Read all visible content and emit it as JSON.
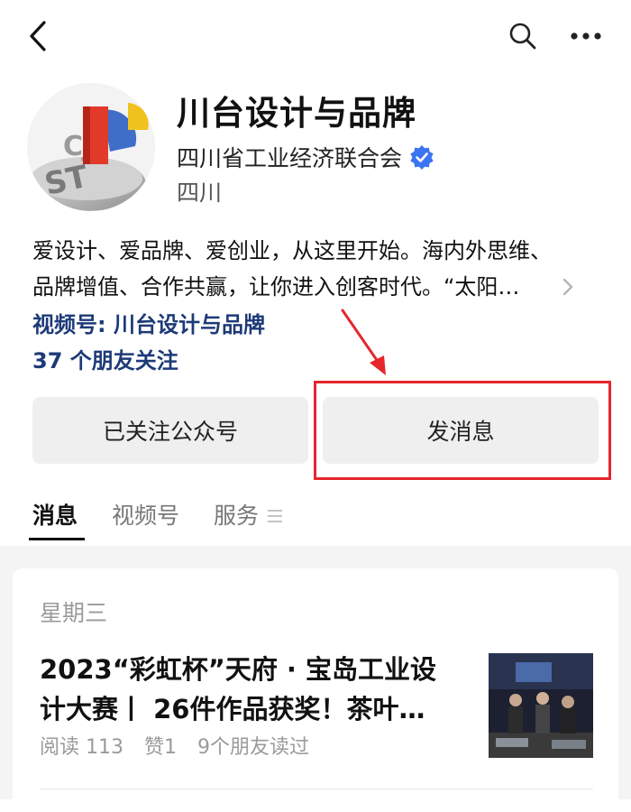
{
  "header": {
    "back_icon": "chevron-left-icon",
    "search_icon": "search-icon",
    "more_icon": "more-dots-icon"
  },
  "profile": {
    "avatar_logo_text": "CJ ST",
    "name": "川台设计与品牌",
    "organization": "四川省工业经济联合会",
    "verified_icon": "verified-badge-icon",
    "verified_color": "#3b74f2",
    "region": "四川"
  },
  "description": {
    "line1": "爱设计、爱品牌、爱创业，从这里开始。海内外思维、",
    "line2": "品牌增值、合作共赢，让你进入创客时代。“太阳…",
    "expand_icon": "chevron-right-icon"
  },
  "channel": {
    "link_text": "视频号: 川台设计与品牌",
    "friends_text": "37 个朋友关注",
    "link_color": "#1d3a78"
  },
  "actions": {
    "followed_label": "已关注公众号",
    "message_label": "发消息",
    "highlight_color": "#e5262d"
  },
  "tabs": {
    "items": [
      "消息",
      "视频号",
      "服务"
    ],
    "active": "消息",
    "menu_icon": "menu-lines-icon"
  },
  "feed": {
    "date": "星期三",
    "article": {
      "title_line1": "2023“彩虹杯”天府 · 宝岛工业设",
      "title_line2": "计大赛丨 26件作品获奖！茶叶…",
      "reads": "阅读 113",
      "likes": "赞1",
      "friends_read": "9个朋友读过"
    }
  }
}
